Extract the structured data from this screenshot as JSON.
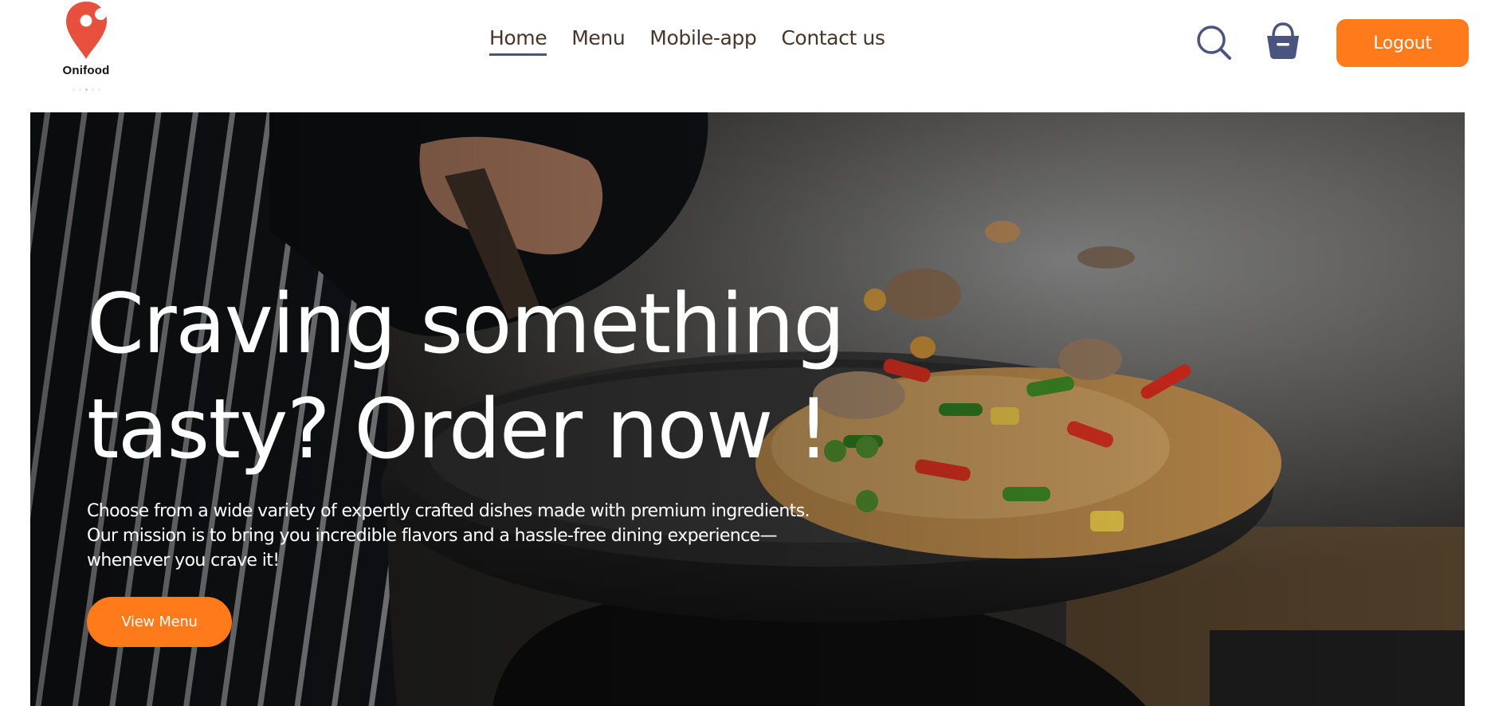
{
  "brand": {
    "name": "Onifood",
    "logo_icon": "map-pin-with-bite-icon",
    "logo_color": "#e8503e"
  },
  "nav": {
    "items": [
      {
        "label": "Home",
        "active": true
      },
      {
        "label": "Menu",
        "active": false
      },
      {
        "label": "Mobile-app",
        "active": false
      },
      {
        "label": "Contact us",
        "active": false
      }
    ]
  },
  "header": {
    "search_icon": "search-icon",
    "basket_icon": "basket-icon",
    "logout_label": "Logout"
  },
  "hero": {
    "title": "Craving something tasty? Order now !",
    "description": "Choose from a wide variety of expertly crafted dishes made with premium ingredients. Our mission is to bring you incredible flavors and a hassle-free dining experience—whenever you crave it!",
    "cta_label": "View Menu",
    "image": "chef-tossing-stir-fry-in-wok-photo"
  },
  "colors": {
    "accent": "#ff7a1a",
    "nav_text": "#49352a",
    "active_underline": "#49557e",
    "icon_color": "#49557e"
  }
}
